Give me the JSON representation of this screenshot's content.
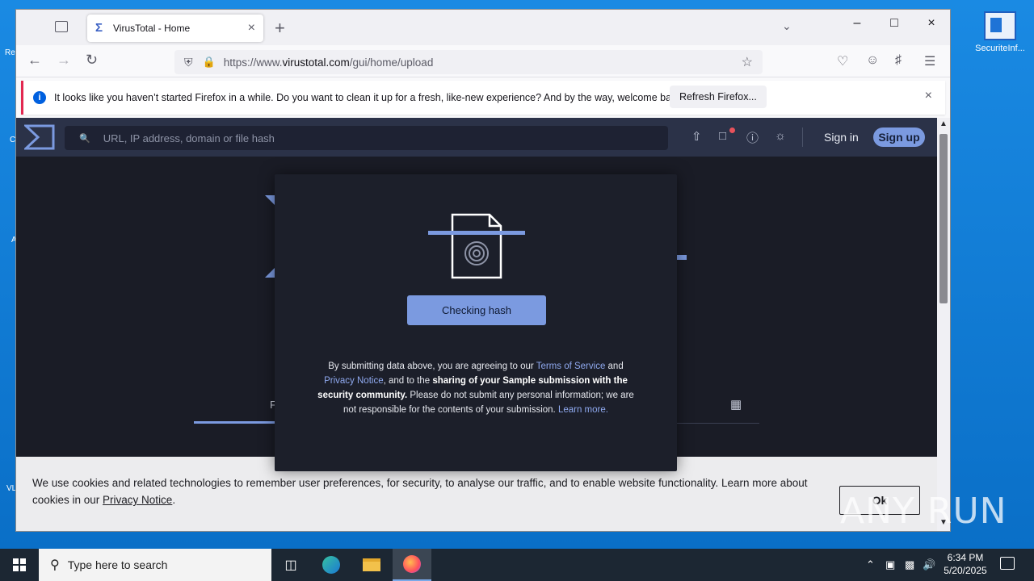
{
  "desktop": {
    "icon_label": "SecuriteInf...",
    "left_stub_labels": [
      "Re",
      "C",
      "A",
      "VL"
    ]
  },
  "browser": {
    "tab_title": "VirusTotal - Home",
    "url_prefix": "https://www.",
    "url_domain": "virustotal.com",
    "url_path": "/gui/home/upload",
    "notification": {
      "message": "It looks like you haven’t started Firefox in a while. Do you want to clean it up for a fresh, like-new experience? And by the way, welcome back!",
      "button": "Refresh Firefox..."
    }
  },
  "virustotal": {
    "search_placeholder": "URL, IP address, domain or file hash",
    "sign_in": "Sign in",
    "sign_up": "Sign up",
    "bg_tab_label": "F",
    "modal": {
      "button": "Checking hash",
      "legal_1": "By submitting data above, you are agreeing to our ",
      "terms": "Terms of Service",
      "and": " and ",
      "privacy": "Privacy Notice",
      "legal_2": ", and to the ",
      "bold": "sharing of your Sample submission with the security community.",
      "legal_3": " Please do not submit any personal information; we are not responsible for the contents of your submission. ",
      "learn_more": "Learn more."
    },
    "cookie": {
      "text": "We use cookies and related technologies to remember user preferences, for security, to analyse our traffic, and to enable website functionality. Learn more about cookies in our ",
      "link": "Privacy Notice",
      "end": ".",
      "ok": "Ok"
    }
  },
  "taskbar": {
    "search_placeholder": "Type here to search",
    "time": "6:34 PM",
    "date": "5/20/2025"
  },
  "watermark": "ANY RUN",
  "colors": {
    "accent": "#7b9ae0",
    "header": "#2b3248",
    "page_bg": "#1a1c26",
    "modal_bg": "#1c1f2a",
    "notification_bar": "#e22850"
  }
}
